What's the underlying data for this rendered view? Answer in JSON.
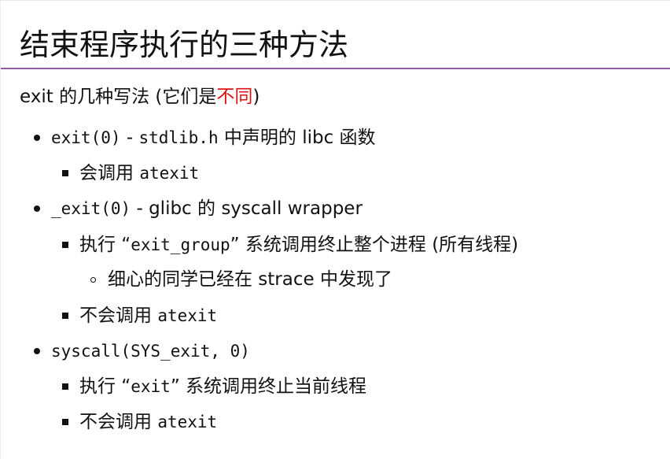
{
  "slide": {
    "title": "结束程序执行的三种方法",
    "intro": {
      "prefix": "exit 的几种写法 (它们是",
      "highlight": "不同",
      "suffix": ")"
    },
    "items": [
      {
        "code": "exit(0)",
        "sep": " - ",
        "code2": "stdlib.h",
        "text": " 中声明的 libc 函数",
        "sub": [
          {
            "text": "会调用 ",
            "code": "atexit"
          }
        ]
      },
      {
        "code": "_exit(0)",
        "text": " - glibc 的 syscall wrapper",
        "sub": [
          {
            "pre": "执行 “",
            "code": "exit_group",
            "post": "” 系统调用终止整个进程 (所有线程)",
            "sub": [
              {
                "text": "细心的同学已经在 strace 中发现了"
              }
            ]
          },
          {
            "text": "不会调用 ",
            "code": "atexit"
          }
        ]
      },
      {
        "code": "syscall(SYS_exit, 0)",
        "sub": [
          {
            "pre": "执行 “",
            "code": "exit",
            "post": "” 系统调用终止当前线程"
          },
          {
            "text": "不会调用 ",
            "code": "atexit"
          }
        ]
      }
    ]
  }
}
